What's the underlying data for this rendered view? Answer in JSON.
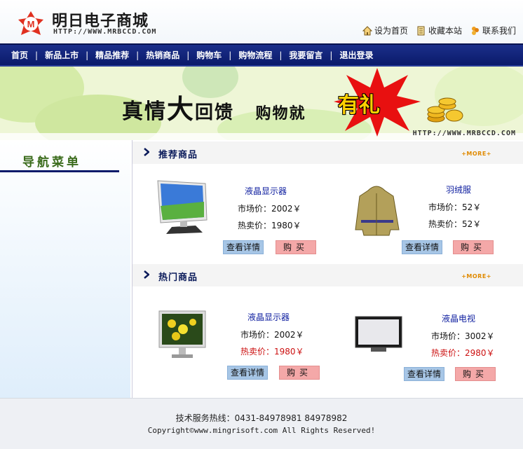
{
  "header": {
    "brand_title": "明日电子商城",
    "brand_url": "HTTP://WWW.MRBCCD.COM",
    "links": [
      {
        "label": "设为首页",
        "icon": "home-icon"
      },
      {
        "label": "收藏本站",
        "icon": "bookmark-icon"
      },
      {
        "label": "联系我们",
        "icon": "contact-icon"
      }
    ]
  },
  "nav": {
    "items": [
      "首页",
      "新品上市",
      "精品推荐",
      "热销商品",
      "购物车",
      "购物流程",
      "我要留言",
      "退出登录"
    ],
    "separator": "|"
  },
  "banner": {
    "part1": "真情",
    "part2": "大",
    "part3": "回馈",
    "part4": "购物就",
    "highlight": "有礼",
    "url": "HTTP://WWW.MRBCCD.COM"
  },
  "sidebar": {
    "title": "导航菜单"
  },
  "recommended": {
    "title": "推荐商品",
    "more": "+MORE+",
    "products": [
      {
        "name": "液晶显示器",
        "market_label": "市场价：",
        "market_price": "2002￥",
        "sale_label": "热卖价：",
        "sale_price": "1980￥",
        "detail": "查看详情",
        "buy": "购买"
      },
      {
        "name": "羽绒服",
        "market_label": "市场价：",
        "market_price": "52￥",
        "sale_label": "热卖价：",
        "sale_price": "52￥",
        "detail": "查看详情",
        "buy": "购买"
      }
    ]
  },
  "hot": {
    "title": "热门商品",
    "more": "+MORE+",
    "products": [
      {
        "name": "液晶显示器",
        "market_label": "市场价：",
        "market_price": "2002￥",
        "sale_label": "热卖价：",
        "sale_price": "1980￥",
        "detail": "查看详情",
        "buy": "购买"
      },
      {
        "name": "液晶电视",
        "market_label": "市场价：",
        "market_price": "3002￥",
        "sale_label": "热卖价：",
        "sale_price": "2980￥",
        "detail": "查看详情",
        "buy": "购买"
      }
    ]
  },
  "footer": {
    "hotline": "技术服务热线：0431-84978981  84978982",
    "copyright": "Copyright©www.mingrisoft.com All Rights Reserved!"
  },
  "colors": {
    "nav_bg": "#0a1a6a",
    "accent_red": "#cc1010",
    "detail_btn": "#a7c6e6",
    "buy_btn": "#f4a8a8"
  }
}
